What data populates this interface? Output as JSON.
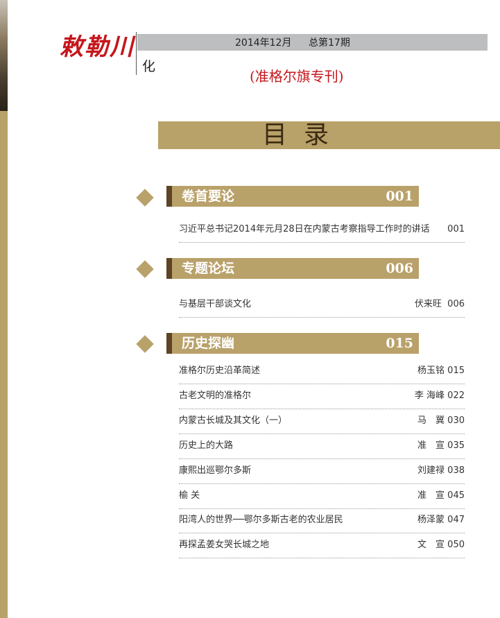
{
  "header": {
    "logo_text": "敕勒川",
    "logo_sub": "文化",
    "issue_date": "2014年12月",
    "issue_number": "总第17期",
    "special_edition": "(准格尔旗专刊)"
  },
  "contents_title": "目录",
  "sections": [
    {
      "title": "卷首要论",
      "page": "001",
      "entries": [
        {
          "title": "习近平总书记2014年元月28日在内蒙古考察指导工作时的讲话",
          "author": "",
          "page": "001"
        }
      ]
    },
    {
      "title": "专题论坛",
      "page": "006",
      "entries": [
        {
          "title": "与基层干部谈文化",
          "author": "伏来旺",
          "page": "006"
        }
      ]
    },
    {
      "title": "历史探幽",
      "page": "015",
      "entries": [
        {
          "title": "准格尔历史沿革简述",
          "author": "杨玉铭",
          "page": "015"
        },
        {
          "title": "古老文明的准格尔",
          "author": "李 海峰",
          "page": "022"
        },
        {
          "title": "内蒙古长城及其文化（一）",
          "author": "马　冀",
          "page": "030"
        },
        {
          "title": "历史上的大路",
          "author": "准　宣",
          "page": "035"
        },
        {
          "title": "康熙出巡鄂尔多斯",
          "author": "刘建禄",
          "page": "038"
        },
        {
          "title": "榆 关",
          "author": "准　宣",
          "page": "045"
        },
        {
          "title": "阳湾人的世界──鄂尔多斯古老的农业居民",
          "author": "杨泽蒙",
          "page": "047"
        },
        {
          "title": "再探孟姜女哭长城之地",
          "author": "文　宣",
          "page": "050"
        }
      ]
    }
  ]
}
